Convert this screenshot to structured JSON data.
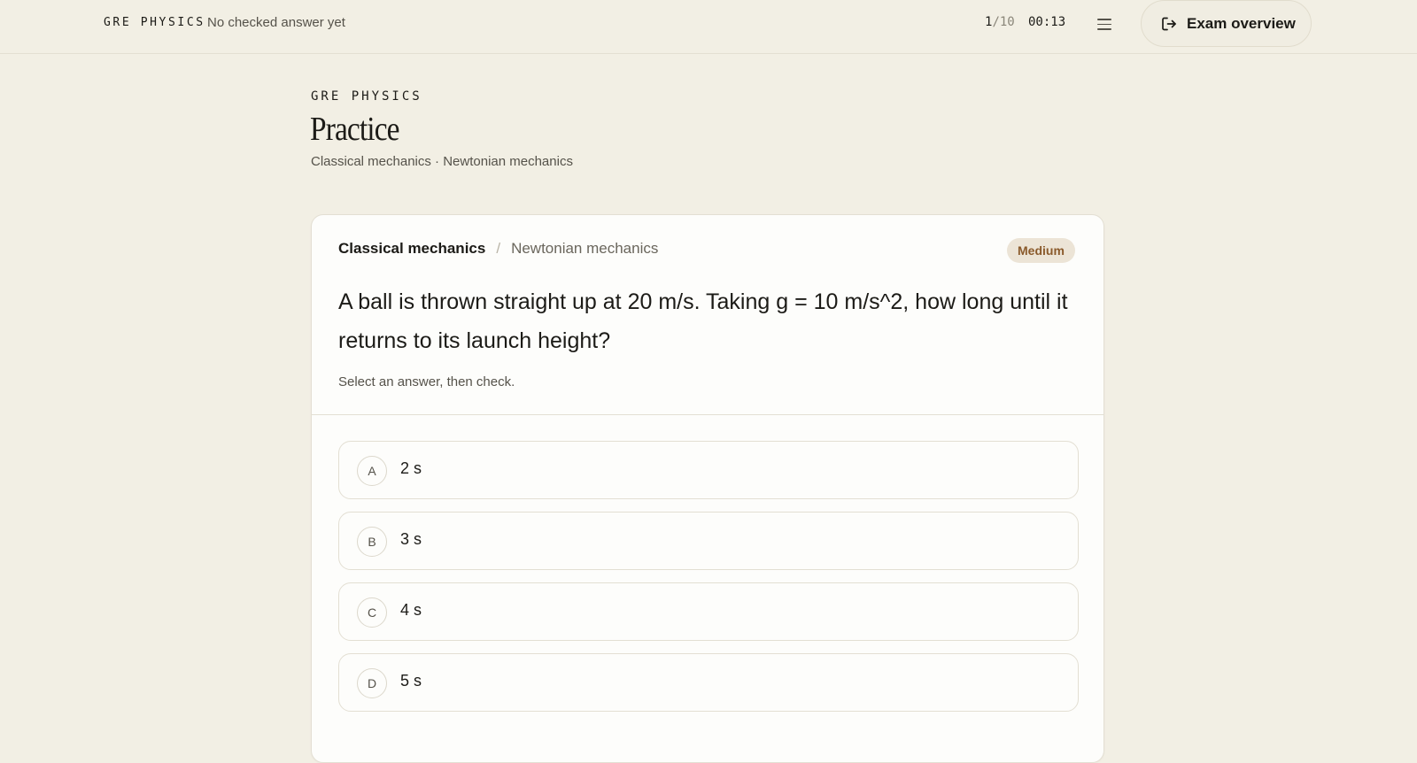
{
  "topbar": {
    "brand": "GRE PHYSICS",
    "status": "No checked answer yet",
    "progress_current": "1",
    "progress_separator": "/",
    "progress_total": "10",
    "timer": "00:13",
    "menu_icon": "hamburger-menu-icon",
    "overview_icon": "logout-arrow-icon",
    "overview_label": "Exam overview"
  },
  "header": {
    "eyebrow": "GRE PHYSICS",
    "title": "Practice",
    "subtitle": "Classical mechanics · Newtonian mechanics"
  },
  "question_card": {
    "topic": "Classical mechanics",
    "crumb_separator": "/",
    "subtopic": "Newtonian mechanics",
    "difficulty": "Medium",
    "question": "A ball is thrown straight up at 20 m/s. Taking g = 10 m/s^2, how long until it returns to its launch height?",
    "instruction": "Select an answer, then check.",
    "options": [
      {
        "letter": "A",
        "text": "2 s"
      },
      {
        "letter": "B",
        "text": "3 s"
      },
      {
        "letter": "C",
        "text": "4 s"
      },
      {
        "letter": "D",
        "text": "5 s"
      }
    ]
  },
  "colors": {
    "background": "#f2efe4",
    "card": "#fdfdfb",
    "badge_bg": "#ece4d6",
    "badge_text": "#8a5a2b",
    "text": "#1c1b17",
    "muted": "#55524a"
  }
}
